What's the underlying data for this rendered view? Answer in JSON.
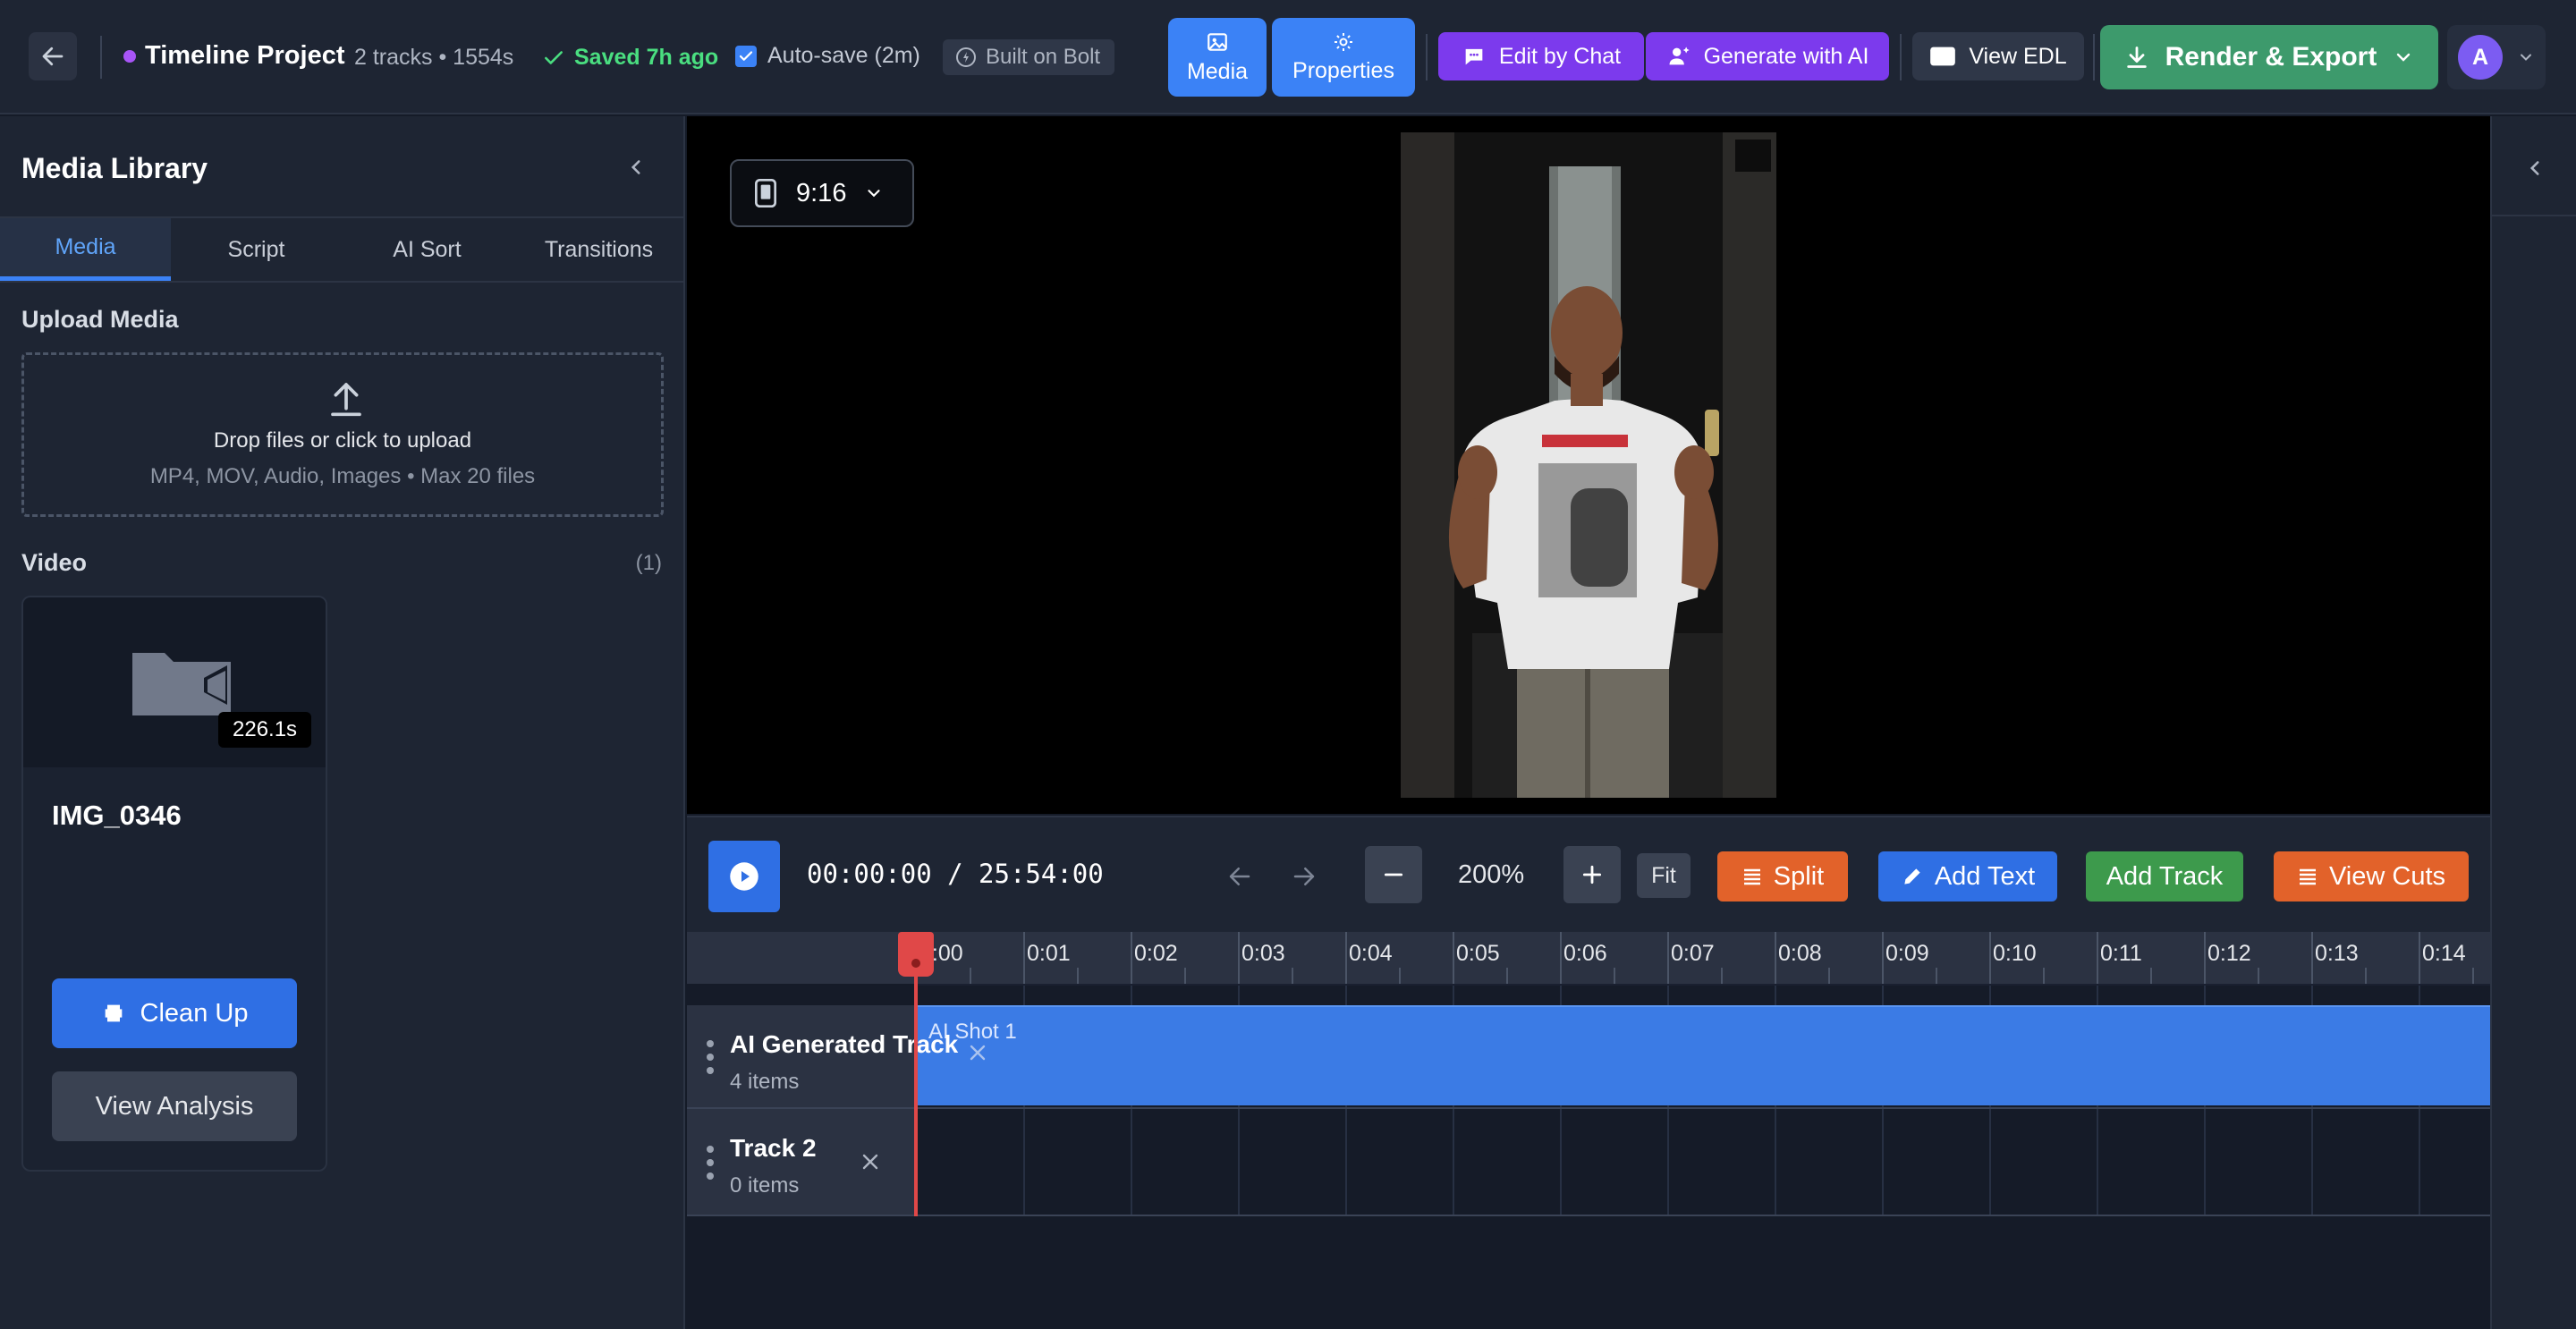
{
  "header": {
    "project_title": "Timeline Project",
    "meta": "2 tracks • 1554s",
    "saved": "Saved 7h ago",
    "autosave": "Auto-save (2m)",
    "built_on": "Built on Bolt",
    "media_btn": "Media",
    "properties_btn": "Properties",
    "edit_chat_btn": "Edit by Chat",
    "generate_ai_btn": "Generate with AI",
    "view_edl_btn": "View EDL",
    "render_btn": "Render & Export",
    "avatar": "A",
    "colors": {
      "accent": "#3b82f6",
      "purple": "#7c3aed",
      "green": "#3d9a6c",
      "saved": "#4ade80"
    }
  },
  "sidebar": {
    "title": "Media Library",
    "tabs": [
      {
        "label": "Media",
        "active": true
      },
      {
        "label": "Script",
        "active": false
      },
      {
        "label": "AI Sort",
        "active": false
      },
      {
        "label": "Transitions",
        "active": false
      }
    ],
    "upload_title": "Upload Media",
    "upload_text": "Drop files or click to upload",
    "upload_hint": "MP4, MOV, Audio, Images • Max 20 files",
    "video_section": "Video",
    "video_count": "(1)",
    "clip": {
      "duration": "226.1s",
      "name": "IMG_0346",
      "cleanup_btn": "Clean Up",
      "analysis_btn": "View Analysis"
    }
  },
  "preview": {
    "aspect": "9:16"
  },
  "controls": {
    "timecode": "00:00:00 / 25:54:00",
    "zoom": "200%",
    "fit": "Fit",
    "split": "Split",
    "add_text": "Add Text",
    "add_track": "Add Track",
    "view_cuts": "View Cuts"
  },
  "timeline": {
    "ticks": [
      "0:00",
      "0:01",
      "0:02",
      "0:03",
      "0:04",
      "0:05",
      "0:06",
      "0:07",
      "0:08",
      "0:09",
      "0:10",
      "0:11",
      "0:12",
      "0:13",
      "0:14"
    ],
    "tracks": [
      {
        "name": "AI Generated Track",
        "items": "4 items",
        "clip_label": "AI Shot 1"
      },
      {
        "name": "Track 2",
        "items": "0 items"
      }
    ]
  }
}
